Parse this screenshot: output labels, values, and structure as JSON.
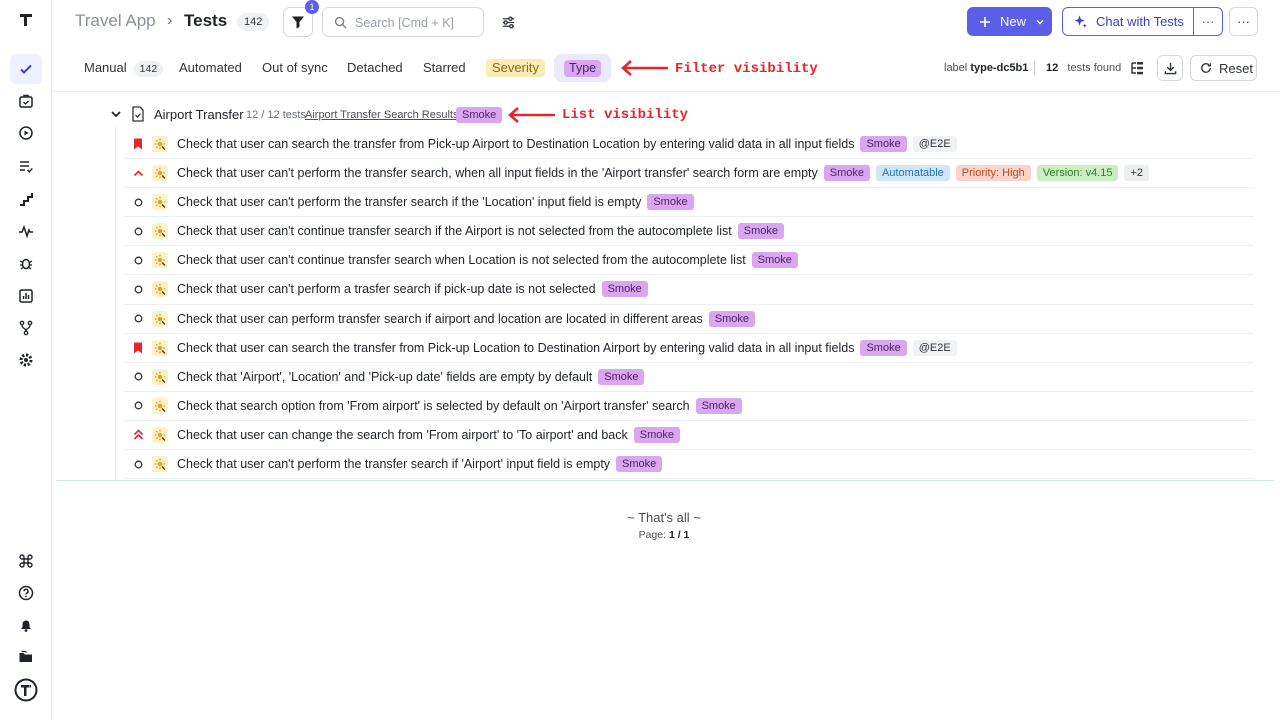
{
  "header": {
    "app_name": "Travel App",
    "separator": "›",
    "page_title": "Tests",
    "tests_count": "142",
    "filter_badge": "1",
    "search_placeholder": "Search [Cmd + K]",
    "new_label": "New",
    "chat_label": "Chat with Tests",
    "more_symbol": "···"
  },
  "tabs": {
    "manual": "Manual",
    "manual_count": "142",
    "automated": "Automated",
    "out_of_sync": "Out of sync",
    "detached": "Detached",
    "starred": "Starred",
    "severity": "Severity",
    "type": "Type"
  },
  "toolbar_right": {
    "label_prefix": "label",
    "label_value": "type-dc5b1",
    "found_count": "12",
    "found_text": "tests found",
    "reset_label": "Reset"
  },
  "annotations": {
    "filter": "Filter visibility",
    "list": "List visibility"
  },
  "suite": {
    "title": "Airport Transfer",
    "count": "12 / 12 tests",
    "link": "Airport Transfer Search Results",
    "tag": "Smoke"
  },
  "tests": [
    {
      "status": "bookmark-red",
      "title": "Check that user can search the transfer from Pick-up Airport to Destination Location by entering valid data in all input fields",
      "tags": [
        "Smoke",
        "@E2E"
      ]
    },
    {
      "status": "chevron-up-red",
      "title": "Check that user can't perform the transfer search, when all input fields in the 'Airport transfer' search form are empty",
      "tags": [
        "Smoke",
        "Automatable",
        "Priority: High",
        "Version: v4.15",
        "+2"
      ]
    },
    {
      "status": "circle",
      "title": "Check that user can't perform the transfer search if the 'Location' input field is empty",
      "tags": [
        "Smoke"
      ]
    },
    {
      "status": "circle",
      "title": "Check that user can't continue transfer search if the Airport is not selected from the autocomplete list",
      "tags": [
        "Smoke"
      ]
    },
    {
      "status": "circle",
      "title": "Check that user can't continue transfer search when Location is not selected from the autocomplete list",
      "tags": [
        "Smoke"
      ]
    },
    {
      "status": "circle",
      "title": "Check that user can't perform a trasfer search if pick-up date is not selected",
      "tags": [
        "Smoke"
      ]
    },
    {
      "status": "circle",
      "title": "Check that user can perform transfer search if airport and location are located in different areas",
      "tags": [
        "Smoke"
      ]
    },
    {
      "status": "bookmark-red",
      "title": "Check that user can search the transfer from Pick-up Location to Destination Airport by entering valid data in all input fields",
      "tags": [
        "Smoke",
        "@E2E"
      ]
    },
    {
      "status": "circle",
      "title": "Check that 'Airport', 'Location' and 'Pick-up date' fields are empty by default",
      "tags": [
        "Smoke"
      ]
    },
    {
      "status": "circle",
      "title": "Check that search option from 'From airport' is selected by default on 'Airport transfer' search",
      "tags": [
        "Smoke"
      ]
    },
    {
      "status": "double-chevron-up-red",
      "title": "Check that user can change the search from 'From airport' to 'To airport' and back",
      "tags": [
        "Smoke"
      ]
    },
    {
      "status": "circle",
      "title": "Check that user can't perform the transfer search if 'Airport' input field is empty",
      "tags": [
        "Smoke"
      ]
    }
  ],
  "footer": {
    "thats_all": "~ That's all ~",
    "page_label": "Page:",
    "page_value": "1 / 1"
  },
  "colors": {
    "accent": "#5b5ee6",
    "annotation": "#e5262a",
    "smoke_tag": "#d9a7f0",
    "severity_tag": "#faecb7"
  },
  "icons": {
    "sidebar": [
      "logo-icon",
      "check-icon",
      "briefcase-icon",
      "play-circle-icon",
      "list-check-icon",
      "steps-icon",
      "pulse-icon",
      "bug-icon",
      "chart-icon",
      "branch-icon",
      "gear-icon",
      "command-icon",
      "help-icon",
      "bell-icon",
      "folder-icon",
      "profile-logo-icon"
    ]
  }
}
